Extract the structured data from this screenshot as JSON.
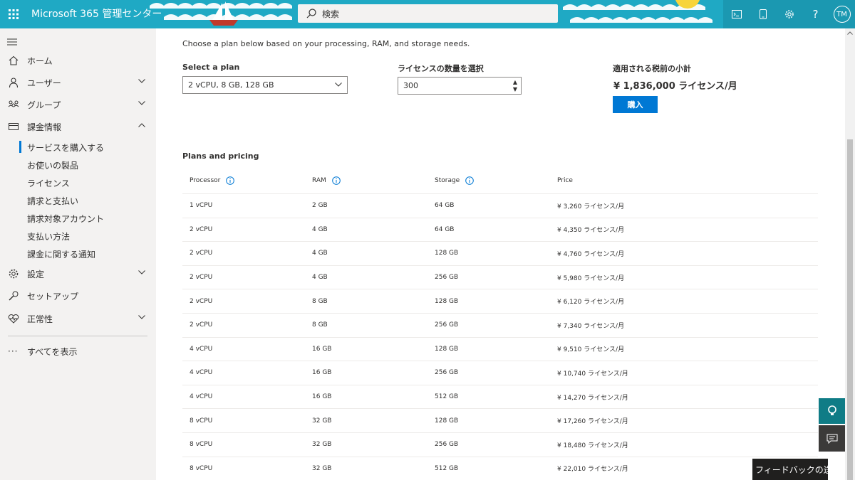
{
  "header": {
    "app_title": "Microsoft 365 管理センター",
    "search_placeholder": "検索",
    "avatar_initials": "TM",
    "icons": [
      "waffle-icon",
      "cloud-shell-icon",
      "mobile-icon",
      "gear-icon",
      "help-icon"
    ]
  },
  "sidebar": {
    "items": [
      {
        "label": "ホーム",
        "icon": "home-icon",
        "chevron": ""
      },
      {
        "label": "ユーザー",
        "icon": "user-icon",
        "chevron": "down"
      },
      {
        "label": "グループ",
        "icon": "group-icon",
        "chevron": "down"
      },
      {
        "label": "課金情報",
        "icon": "billing-icon",
        "chevron": "up"
      }
    ],
    "billing_sub": [
      {
        "label": "サービスを購入する",
        "selected": true
      },
      {
        "label": "お使いの製品"
      },
      {
        "label": "ライセンス"
      },
      {
        "label": "請求と支払い"
      },
      {
        "label": "請求対象アカウント"
      },
      {
        "label": "支払い方法"
      },
      {
        "label": "課金に関する通知"
      }
    ],
    "items2": [
      {
        "label": "設定",
        "icon": "gear-icon",
        "chevron": "down"
      },
      {
        "label": "セットアップ",
        "icon": "wrench-icon",
        "chevron": ""
      },
      {
        "label": "正常性",
        "icon": "heart-icon",
        "chevron": "down"
      }
    ],
    "show_all": "すべてを表示"
  },
  "main": {
    "intro": "Choose a plan below based on your processing, RAM, and storage needs.",
    "select_plan_label": "Select a plan",
    "select_plan_value": "2 vCPU, 8 GB, 128 GB",
    "license_qty_label": "ライセンスの数量を選択",
    "license_qty_value": "300",
    "subtotal_label": "適用される税前の小計",
    "subtotal_value": "¥ 1,836,000 ライセンス/月",
    "buy_label": "購入",
    "plans_title": "Plans and pricing",
    "columns": [
      "Processor",
      "RAM",
      "Storage",
      "Price"
    ],
    "rows": [
      [
        "1 vCPU",
        "2 GB",
        "64 GB",
        "¥ 3,260 ライセンス/月"
      ],
      [
        "2 vCPU",
        "4 GB",
        "64 GB",
        "¥ 4,350 ライセンス/月"
      ],
      [
        "2 vCPU",
        "4 GB",
        "128 GB",
        "¥ 4,760 ライセンス/月"
      ],
      [
        "2 vCPU",
        "4 GB",
        "256 GB",
        "¥ 5,980 ライセンス/月"
      ],
      [
        "2 vCPU",
        "8 GB",
        "128 GB",
        "¥ 6,120 ライセンス/月"
      ],
      [
        "2 vCPU",
        "8 GB",
        "256 GB",
        "¥ 7,340 ライセンス/月"
      ],
      [
        "4 vCPU",
        "16 GB",
        "128 GB",
        "¥ 9,510 ライセンス/月"
      ],
      [
        "4 vCPU",
        "16 GB",
        "256 GB",
        "¥ 10,740 ライセンス/月"
      ],
      [
        "4 vCPU",
        "16 GB",
        "512 GB",
        "¥ 14,270 ライセンス/月"
      ],
      [
        "8 vCPU",
        "32 GB",
        "128 GB",
        "¥ 17,260 ライセンス/月"
      ],
      [
        "8 vCPU",
        "32 GB",
        "256 GB",
        "¥ 18,480 ライセンス/月"
      ],
      [
        "8 vCPU",
        "32 GB",
        "512 GB",
        "¥ 22,010 ライセンス/月"
      ]
    ]
  },
  "feedback_label": "フィードバックの送信",
  "colors": {
    "header": "#1fa9c4",
    "accent": "#0078d4",
    "sidebar": "#f3f2f1"
  }
}
